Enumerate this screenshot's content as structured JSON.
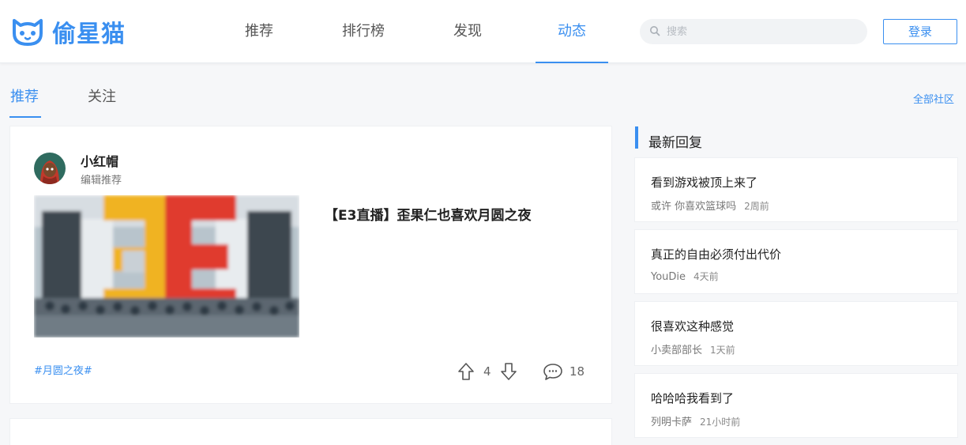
{
  "header": {
    "logo_text": "偷星猫",
    "nav": [
      {
        "label": "推荐"
      },
      {
        "label": "排行榜"
      },
      {
        "label": "发现"
      },
      {
        "label": "动态"
      }
    ],
    "search_placeholder": "搜索",
    "login_label": "登录"
  },
  "subtabs": [
    {
      "label": "推荐"
    },
    {
      "label": "关注"
    }
  ],
  "all_community": "全部社区",
  "post": {
    "author": "小红帽",
    "author_sub": "编辑推荐",
    "title": "【E3直播】歪果仁也喜欢月圆之夜",
    "tag": "#月圆之夜#",
    "upvotes": "4",
    "comments": "18"
  },
  "sidebar": {
    "title": "最新回复",
    "replies": [
      {
        "text": "看到游戏被顶上来了",
        "user": "或许 你喜欢篮球吗",
        "time": "2周前"
      },
      {
        "text": "真正的自由必须付出代价",
        "user": "YouDie",
        "time": "4天前"
      },
      {
        "text": "很喜欢这种感觉",
        "user": "小卖部部长",
        "time": "1天前"
      },
      {
        "text": "哈哈哈我看到了",
        "user": "列明卡萨",
        "time": "21小时前"
      }
    ]
  },
  "colors": {
    "accent": "#3a8ff0",
    "e3_yellow": "#f0b323",
    "e3_red": "#e03a2f"
  }
}
